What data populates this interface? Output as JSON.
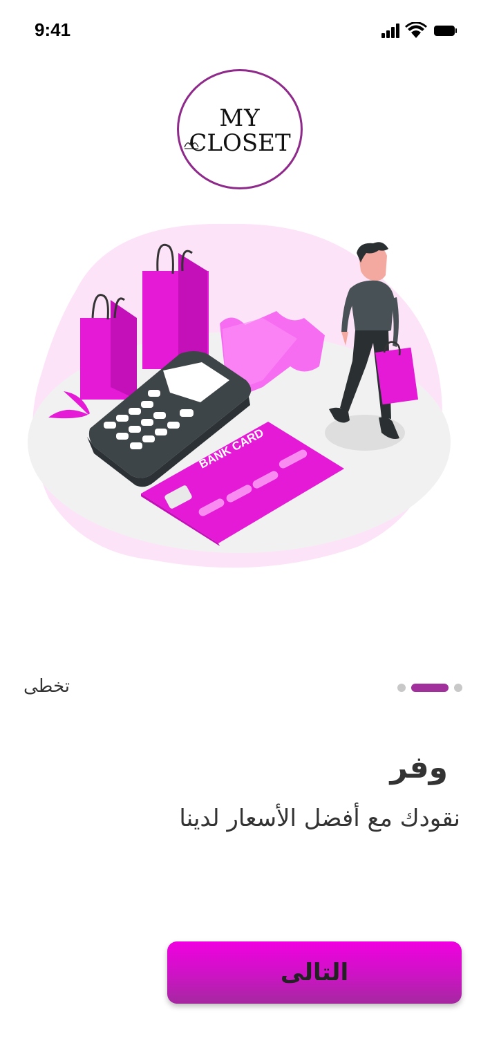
{
  "status_bar": {
    "time": "9:41",
    "icons": [
      "cellular-signal-icon",
      "wifi-icon",
      "battery-icon"
    ]
  },
  "logo": {
    "line1": "MY",
    "line2": "CLOSET"
  },
  "illustration": {
    "card_text": "BANK CARD"
  },
  "onboarding": {
    "skip_label": "تخطى",
    "page_indicator": {
      "total": 3,
      "active": 2
    },
    "title": "وفر",
    "subtitle": "نقودك مع أفضل الأسعار لدينا",
    "next_label": "التالى"
  },
  "colors": {
    "accent": "#e600d8",
    "brand_purple": "#8e2a8a",
    "indicator_active": "#a1309c",
    "indicator_inactive": "#c8c8c8",
    "text": "#333333"
  }
}
